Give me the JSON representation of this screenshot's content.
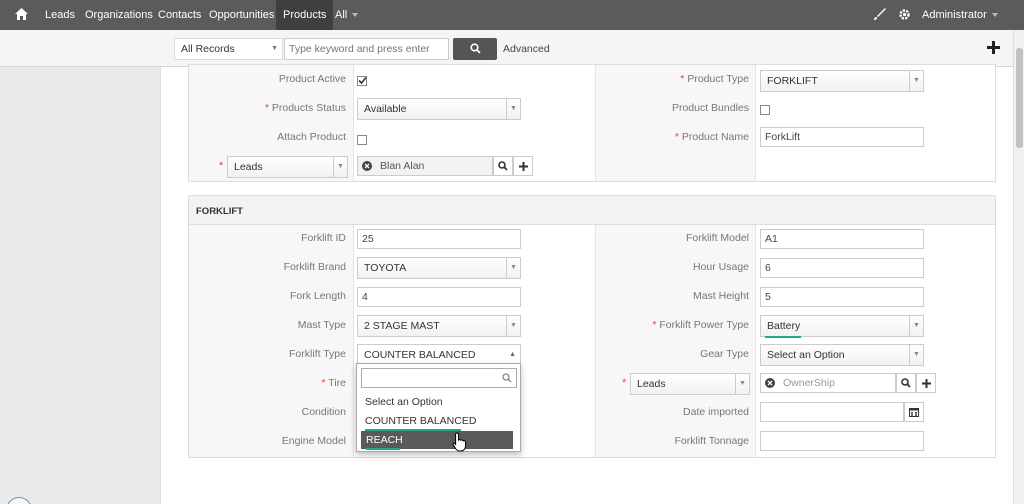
{
  "nav": {
    "items": [
      "Leads",
      "Organizations",
      "Contacts",
      "Opportunities",
      "Products",
      "All"
    ],
    "active": "Products",
    "user": "Administrator"
  },
  "search": {
    "scope": "All Records",
    "placeholder": "Type keyword and press enter",
    "advanced": "Advanced"
  },
  "details": {
    "product_active_label": "Product Active",
    "product_type_label": "Product Type",
    "product_type_value": "FORKLIFT",
    "products_status_label": "Products Status",
    "products_status_value": "Available",
    "product_bundles_label": "Product Bundles",
    "attach_product_label": "Attach Product",
    "product_name_label": "Product Name",
    "product_name_value": "ForkLift",
    "related_module": "Leads",
    "related_value": "Blan Alan"
  },
  "forklift": {
    "title": "FORKLIFT",
    "forklift_id_label": "Forklift ID",
    "forklift_id_value": "25",
    "forklift_model_label": "Forklift Model",
    "forklift_model_value": "A1",
    "forklift_brand_label": "Forklift Brand",
    "forklift_brand_value": "TOYOTA",
    "hour_usage_label": "Hour Usage",
    "hour_usage_value": "6",
    "fork_length_label": "Fork Length",
    "fork_length_value": "4",
    "mast_height_label": "Mast Height",
    "mast_height_value": "5",
    "mast_type_label": "Mast Type",
    "mast_type_value": "2 STAGE MAST",
    "power_type_label": "Forklift Power Type",
    "power_type_value": "Battery",
    "forklift_type_label": "Forklift Type",
    "forklift_type_value": "COUNTER BALANCED",
    "gear_type_label": "Gear Type",
    "gear_type_value": "Select an Option",
    "tire_label": "Tire",
    "owner_module": "Leads",
    "owner_placeholder": "OwnerShip",
    "condition_label": "Condition",
    "date_imported_label": "Date imported",
    "engine_model_label": "Engine Model",
    "tonnage_label": "Forklift Tonnage"
  },
  "dropdown": {
    "options": [
      "Select an Option",
      "COUNTER BALANCED",
      "REACH"
    ],
    "highlighted": "REACH"
  },
  "colors": {
    "accent": "#1fa98a",
    "required": "#e8453c",
    "nav": "#5b5b5b"
  }
}
